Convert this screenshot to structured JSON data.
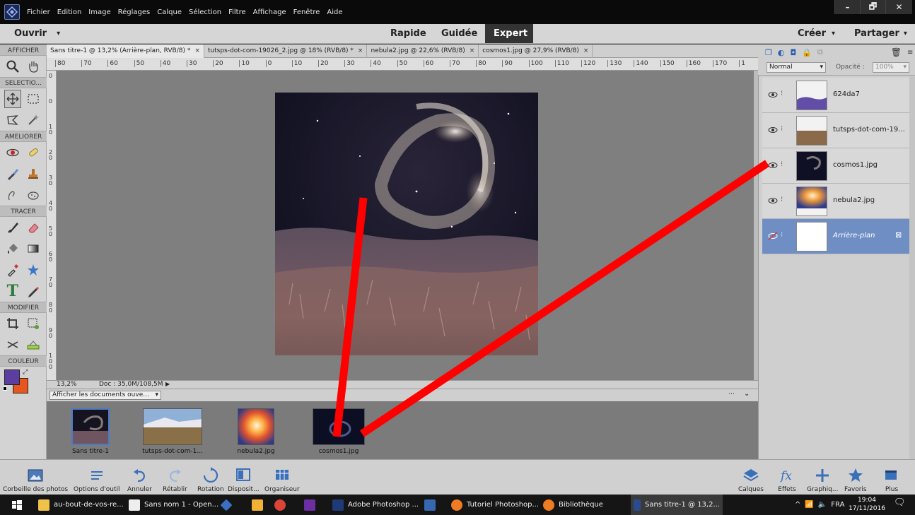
{
  "menubar": {
    "items": [
      "Fichier",
      "Edition",
      "Image",
      "Réglages",
      "Calque",
      "Sélection",
      "Filtre",
      "Affichage",
      "Fenêtre",
      "Aide"
    ],
    "window_minimize": "–",
    "window_restore": "🗗",
    "window_close": "✕"
  },
  "modebar": {
    "open_label": "Ouvrir",
    "open_arrow": "▾",
    "modes": [
      "Rapide",
      "Guidée",
      "Expert"
    ],
    "active_mode": "Expert",
    "create_label": "Créer",
    "share_label": "Partager"
  },
  "toolbar": {
    "sections": [
      "AFFICHER",
      "SELECTIO...",
      "AMELIORER",
      "TRACER",
      "MODIFIER",
      "COULEUR"
    ],
    "fg_color": "#5b3ea0",
    "bg_color": "#e8561e"
  },
  "tabs": [
    {
      "label": "Sans titre-1 @ 13,2% (Arrière-plan, RVB/8) *",
      "active": true
    },
    {
      "label": "tutsps-dot-com-19026_2.jpg @ 18% (RVB/8) *",
      "active": false
    },
    {
      "label": "nebula2.jpg @ 22,6% (RVB/8)",
      "active": false
    },
    {
      "label": "cosmos1.jpg @ 27,9% (RVB/8)",
      "active": false
    }
  ],
  "tab_close": "×",
  "ruler": {
    "h_ticks": [
      "80",
      "70",
      "60",
      "50",
      "40",
      "30",
      "20",
      "10",
      "0",
      "10",
      "20",
      "30",
      "40",
      "50",
      "60",
      "70",
      "80",
      "90",
      "100",
      "110",
      "120",
      "130",
      "140",
      "150",
      "160",
      "170",
      "1"
    ],
    "v_ticks": [
      "0",
      "0",
      "1\n0",
      "2\n0",
      "3\n0",
      "4\n0",
      "5\n0",
      "6\n0",
      "7\n0",
      "8\n0",
      "9\n0",
      "1\n0\n0"
    ]
  },
  "status": {
    "zoom": "13,2%",
    "doc": "Doc : 35,0M/108,5M"
  },
  "bin": {
    "dropdown": "Afficher les documents ouve...",
    "thumbs": [
      "Sans titre-1",
      "tutsps-dot-com-1...",
      "nebula2.jpg",
      "cosmos1.jpg"
    ]
  },
  "layers_panel": {
    "blend_mode": "Normal",
    "opacity_label": "Opacité :",
    "opacity_value": "100%",
    "layers": [
      {
        "name": "624da7",
        "selected": false
      },
      {
        "name": "tutsps-dot-com-19...",
        "selected": false
      },
      {
        "name": "cosmos1.jpg",
        "selected": false
      },
      {
        "name": "nebula2.jpg",
        "selected": false
      },
      {
        "name": "Arrière-plan",
        "selected": true
      }
    ]
  },
  "bottombar": {
    "left": [
      "Corbeille des photos",
      "Options d'outil",
      "Annuler",
      "Rétablir",
      "Rotation",
      "Disposit...",
      "Organiseur"
    ],
    "right": [
      "Calques",
      "Effets",
      "Graphiq...",
      "Favoris",
      "Plus"
    ]
  },
  "taskbar": {
    "items": [
      "au-bout-de-vos-re...",
      "Sans nom 1 - Open...",
      "",
      "",
      "",
      "",
      "Adobe Photoshop ...",
      "",
      "Tutoriel Photoshop...",
      "Bibliothèque",
      "Sans titre-1 @ 13,2..."
    ],
    "lang": "FRA",
    "time": "19:04",
    "date": "17/11/2016"
  },
  "colors": {
    "annotation_red": "#ff0000",
    "selection_blue": "#6f8fc4",
    "mode_active_bg": "#333333"
  }
}
